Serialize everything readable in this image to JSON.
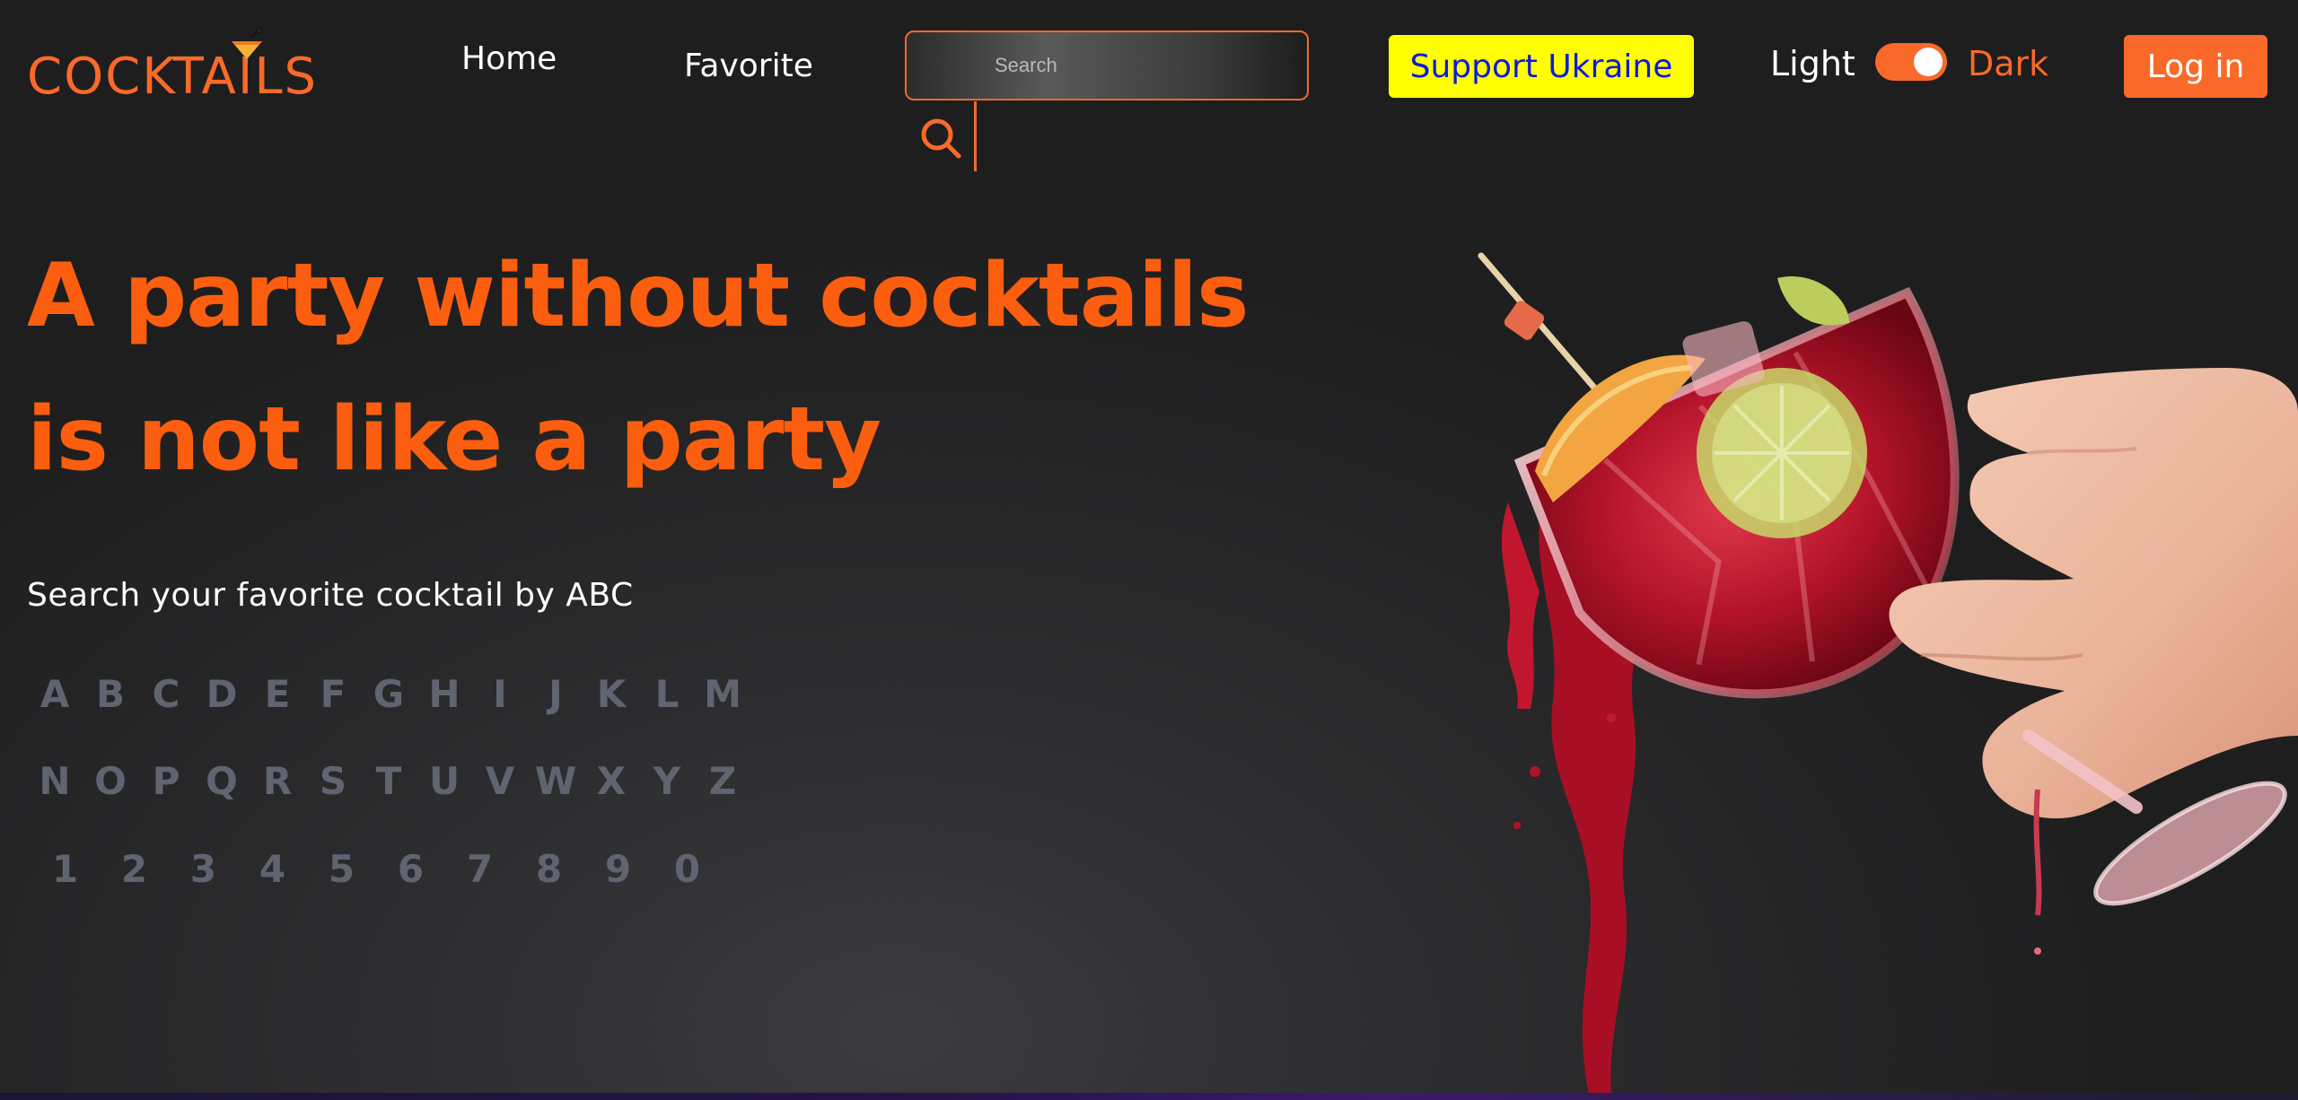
{
  "header": {
    "logo_text": "COCKTAILS",
    "nav": {
      "home": "Home",
      "favorite": "Favorite"
    },
    "search": {
      "placeholder": "Search",
      "value": ""
    },
    "support_label": "Support Ukraine",
    "theme": {
      "light_label": "Light",
      "dark_label": "Dark",
      "dark_enabled": true
    },
    "login_label": "Log in"
  },
  "hero": {
    "title_line_1": "A party without cocktails",
    "title_line_2": "is not like a party",
    "abc_label": "Search your favorite cocktail by ABC",
    "letters_row_1": [
      "A",
      "B",
      "C",
      "D",
      "E",
      "F",
      "G",
      "H",
      "I",
      "J",
      "K",
      "L",
      "M"
    ],
    "letters_row_2": [
      "N",
      "O",
      "P",
      "Q",
      "R",
      "S",
      "T",
      "U",
      "V",
      "W",
      "X",
      "Y",
      "Z"
    ],
    "digits_row": [
      "1",
      "2",
      "3",
      "4",
      "5",
      "6",
      "7",
      "8",
      "9",
      "0"
    ]
  },
  "colors": {
    "accent": "#f96a2a",
    "support_bg": "#ffff00",
    "support_text": "#0d1bdc",
    "letters": "#5f6470"
  },
  "icons": {
    "search": "search-icon",
    "logo_glass": "martini-glass-icon"
  }
}
